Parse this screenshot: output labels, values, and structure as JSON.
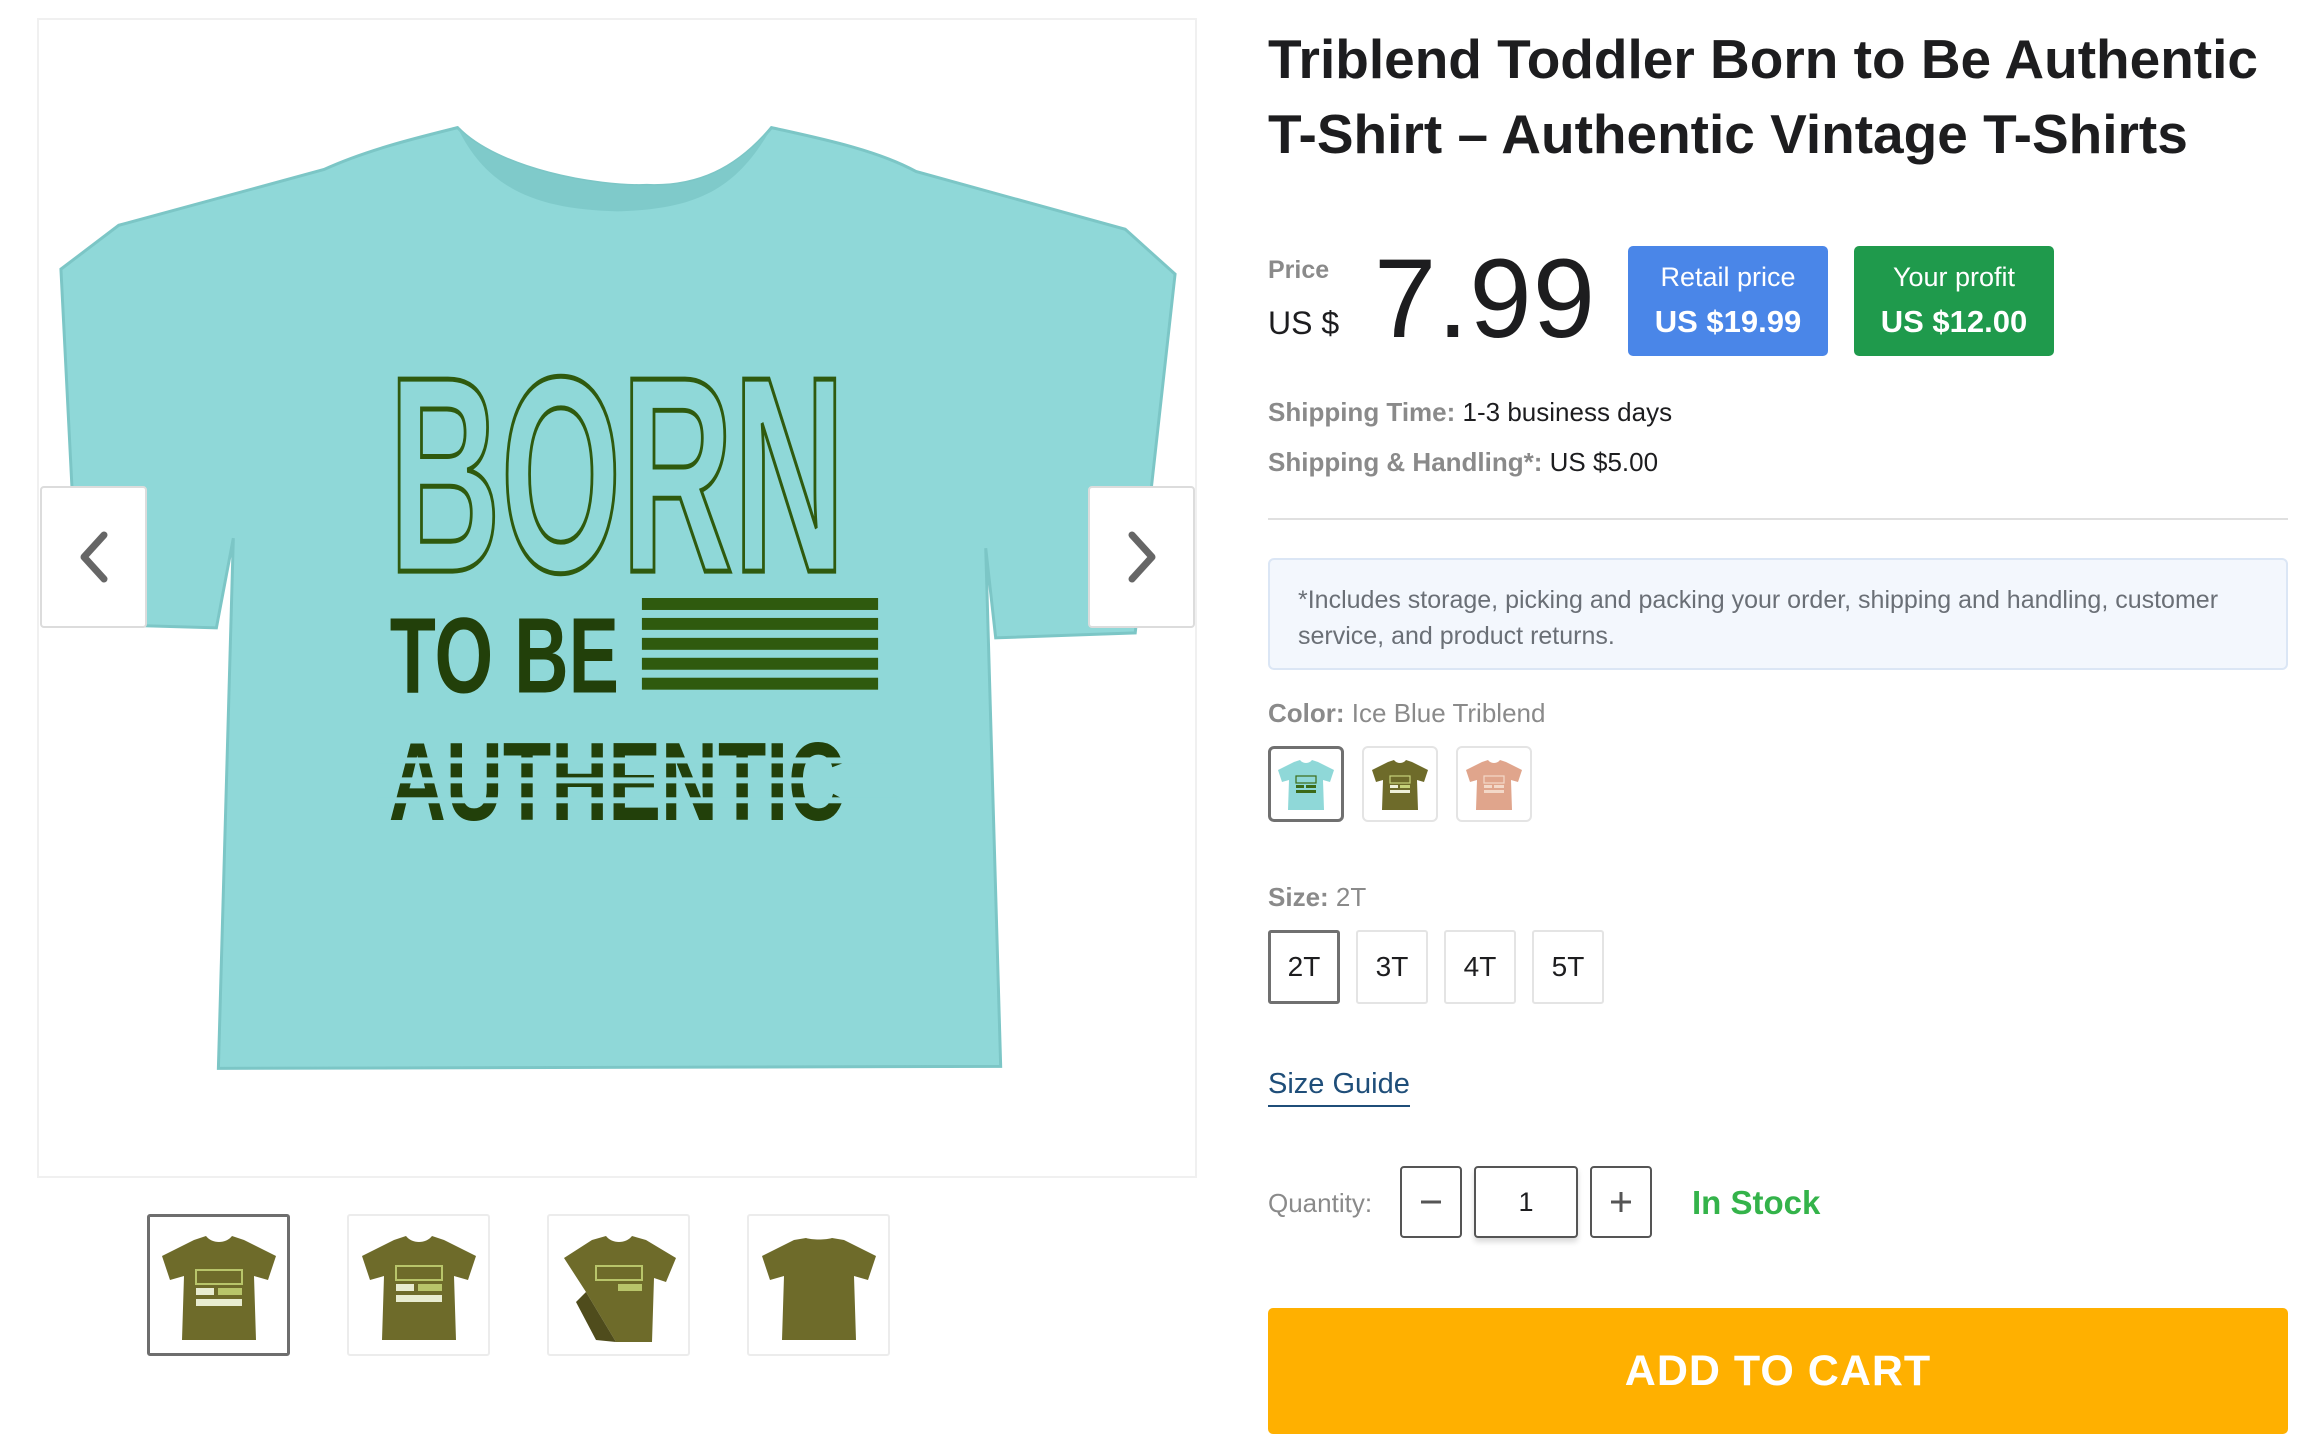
{
  "product": {
    "title": "Triblend Toddler Born to Be Authentic T-Shirt – Authentic Vintage T-Shirts",
    "print_text": [
      "BORN",
      "TO BE",
      "AUTHENTIC"
    ]
  },
  "gallery": {
    "prev_icon": "chevron-left-icon",
    "next_icon": "chevron-right-icon",
    "main_shirt_color": "#8fd8d8",
    "print_color": "#2f5a0e",
    "thumbnails": [
      {
        "view": "front",
        "color": "#6e6b2a",
        "active": true
      },
      {
        "view": "front",
        "color": "#6e6b2a",
        "active": false
      },
      {
        "view": "folded",
        "color": "#6e6b2a",
        "active": false
      },
      {
        "view": "back",
        "color": "#6e6b2a",
        "active": false
      }
    ]
  },
  "pricing": {
    "price_label": "Price",
    "currency": "US $",
    "price": "7.99",
    "retail_label": "Retail price",
    "retail_value": "US $19.99",
    "profit_label": "Your profit",
    "profit_value": "US $12.00",
    "retail_color": "#4a86e8",
    "profit_color": "#1f9a4c"
  },
  "shipping": {
    "time_label": "Shipping Time:",
    "time_value": "1-3 business days",
    "handling_label": "Shipping & Handling*:",
    "handling_value": "US $5.00",
    "note": "*Includes storage, picking and packing your order, shipping and handling, customer service, and product returns."
  },
  "color": {
    "label": "Color:",
    "selected": "Ice Blue Triblend",
    "swatches": [
      {
        "color": "#8fd8d8",
        "active": true
      },
      {
        "color": "#6e6b2a",
        "active": false
      },
      {
        "color": "#e0a58c",
        "active": false
      }
    ]
  },
  "size": {
    "label": "Size:",
    "selected": "2T",
    "options": [
      "2T",
      "3T",
      "4T",
      "5T"
    ]
  },
  "size_guide": "Size Guide",
  "quantity": {
    "label": "Quantity:",
    "value": "1"
  },
  "stock_status": "In Stock",
  "add_to_cart": "ADD TO CART",
  "accent_color": "#ffb000"
}
